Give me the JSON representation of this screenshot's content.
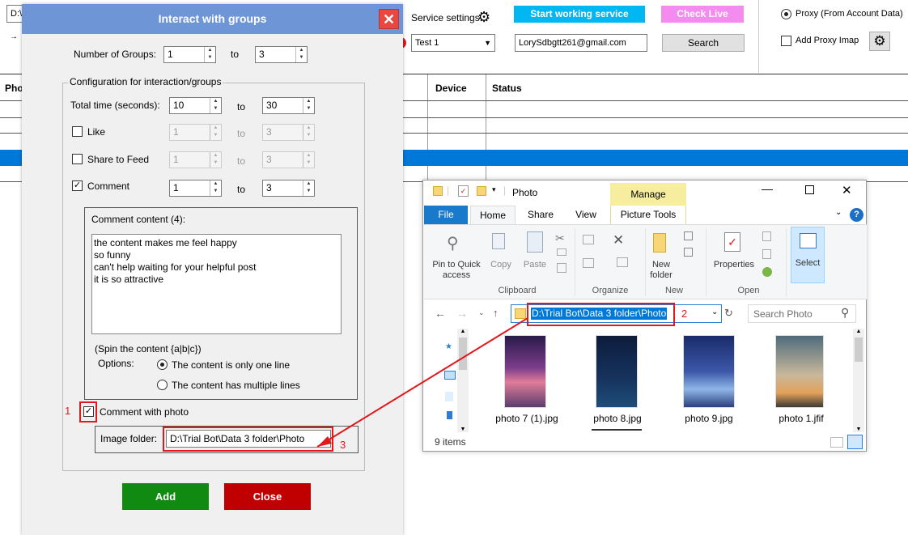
{
  "background": {
    "path_field": "D:\\",
    "service_settings_label": "Service settings",
    "start_button": "Start working service",
    "check_live_button": "Check Live",
    "profile_select": "Test 1",
    "email_field": "LorySdbgtt261@gmail.com",
    "search_button": "Search",
    "proxy_account_label": "Proxy (From Account Data)",
    "add_proxy_label": "Add Proxy Imap",
    "columns": {
      "photo": "Pho",
      "device": "Device",
      "status": "Status"
    }
  },
  "dialog": {
    "title": "Interact with groups",
    "num_groups_label": "Number of Groups:",
    "num_groups_from": "1",
    "num_groups_to": "3",
    "to_label": "to",
    "config_label": "Configuration for interaction/groups",
    "total_time_label": "Total time (seconds):",
    "total_time_from": "10",
    "total_time_to": "30",
    "like_label": "Like",
    "like_from": "1",
    "like_to": "3",
    "share_label": "Share to Feed",
    "share_from": "1",
    "share_to": "3",
    "comment_label": "Comment",
    "comment_from": "1",
    "comment_to": "3",
    "comment_content_label": "Comment content (4):",
    "comment_lines": [
      "the content makes me feel happy",
      "so funny",
      "can't help waiting for your helpful post",
      "it is so attractive"
    ],
    "spin_hint": "(Spin the content {a|b|c})",
    "options_label": "Options:",
    "option_one_line": "The content is only one line",
    "option_multi_line": "The content has multiple lines",
    "comment_with_photo_label": "Comment with photo",
    "image_folder_label": "Image folder:",
    "image_folder_value": "D:\\Trial Bot\\Data 3 folder\\Photo",
    "add_button": "Add",
    "close_button": "Close"
  },
  "annotations": {
    "one": "1",
    "two": "2",
    "three": "3"
  },
  "explorer": {
    "title": "Photo",
    "manage_tab": "Manage",
    "tabs": [
      "File",
      "Home",
      "Share",
      "View",
      "Picture Tools"
    ],
    "pin_label": "Pin to Quick access",
    "copy_label": "Copy",
    "paste_label": "Paste",
    "new_folder_label": "New folder",
    "properties_label": "Properties",
    "select_label": "Select",
    "group_clipboard": "Clipboard",
    "group_organize": "Organize",
    "group_new": "New",
    "group_open": "Open",
    "address": "D:\\Trial Bot\\Data 3 folder\\Photo",
    "search_placeholder": "Search Photo",
    "files": [
      "photo  7 (1).jpg",
      "photo  8.jpg",
      "photo  9.jpg",
      "photo 1.jfif"
    ],
    "items_count": "9 items"
  },
  "colors": {
    "accent": "#00b7f1",
    "check_live": "#f48cf0",
    "title_bar": "#6e95d6",
    "add": "#118a11",
    "close": "#c00000",
    "annotation": "#e3181d",
    "selection": "#0078d7"
  }
}
